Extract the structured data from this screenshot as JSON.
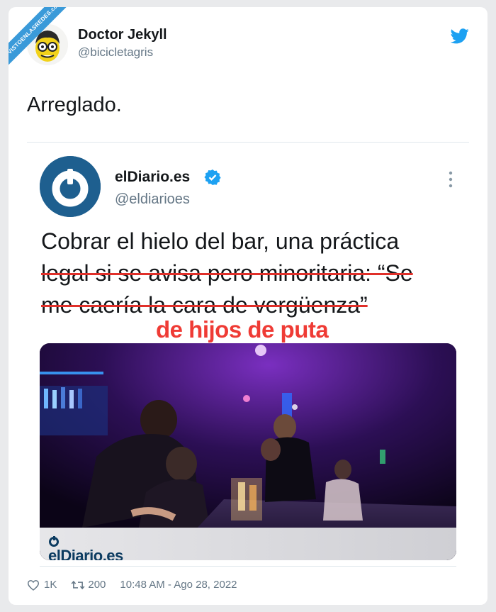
{
  "watermark": "VISTOENLASREDES.com",
  "author": {
    "name": "Doctor Jekyll",
    "handle": "@bicicletagris"
  },
  "tweet": {
    "text": "Arreglado."
  },
  "embedded": {
    "name": "elDiario.es",
    "handle": "@eldiarioes",
    "headline_plain": "Cobrar el hielo del bar, una práctica",
    "headline_struck_1": "legal si se avisa pero minoritaria: “Se",
    "headline_struck_2": "me caería la cara de vergüenza”",
    "overlay": "de hijos de puta",
    "photo_logo": "elDiario.es"
  },
  "footer": {
    "likes": "1K",
    "retweets": "200",
    "timestamp": "10:48 AM - Ago 28, 2022"
  },
  "colors": {
    "twitter_blue": "#1da1f2",
    "strike_red": "#e0302a",
    "overlay_red": "#ef3b35",
    "eldiario_navy": "#1e5f8f"
  },
  "icons": {
    "bird": "twitter-bird-icon",
    "verified": "verified-badge-icon",
    "more": "more-options-icon",
    "like": "heart-icon",
    "retweet": "retweet-icon"
  }
}
